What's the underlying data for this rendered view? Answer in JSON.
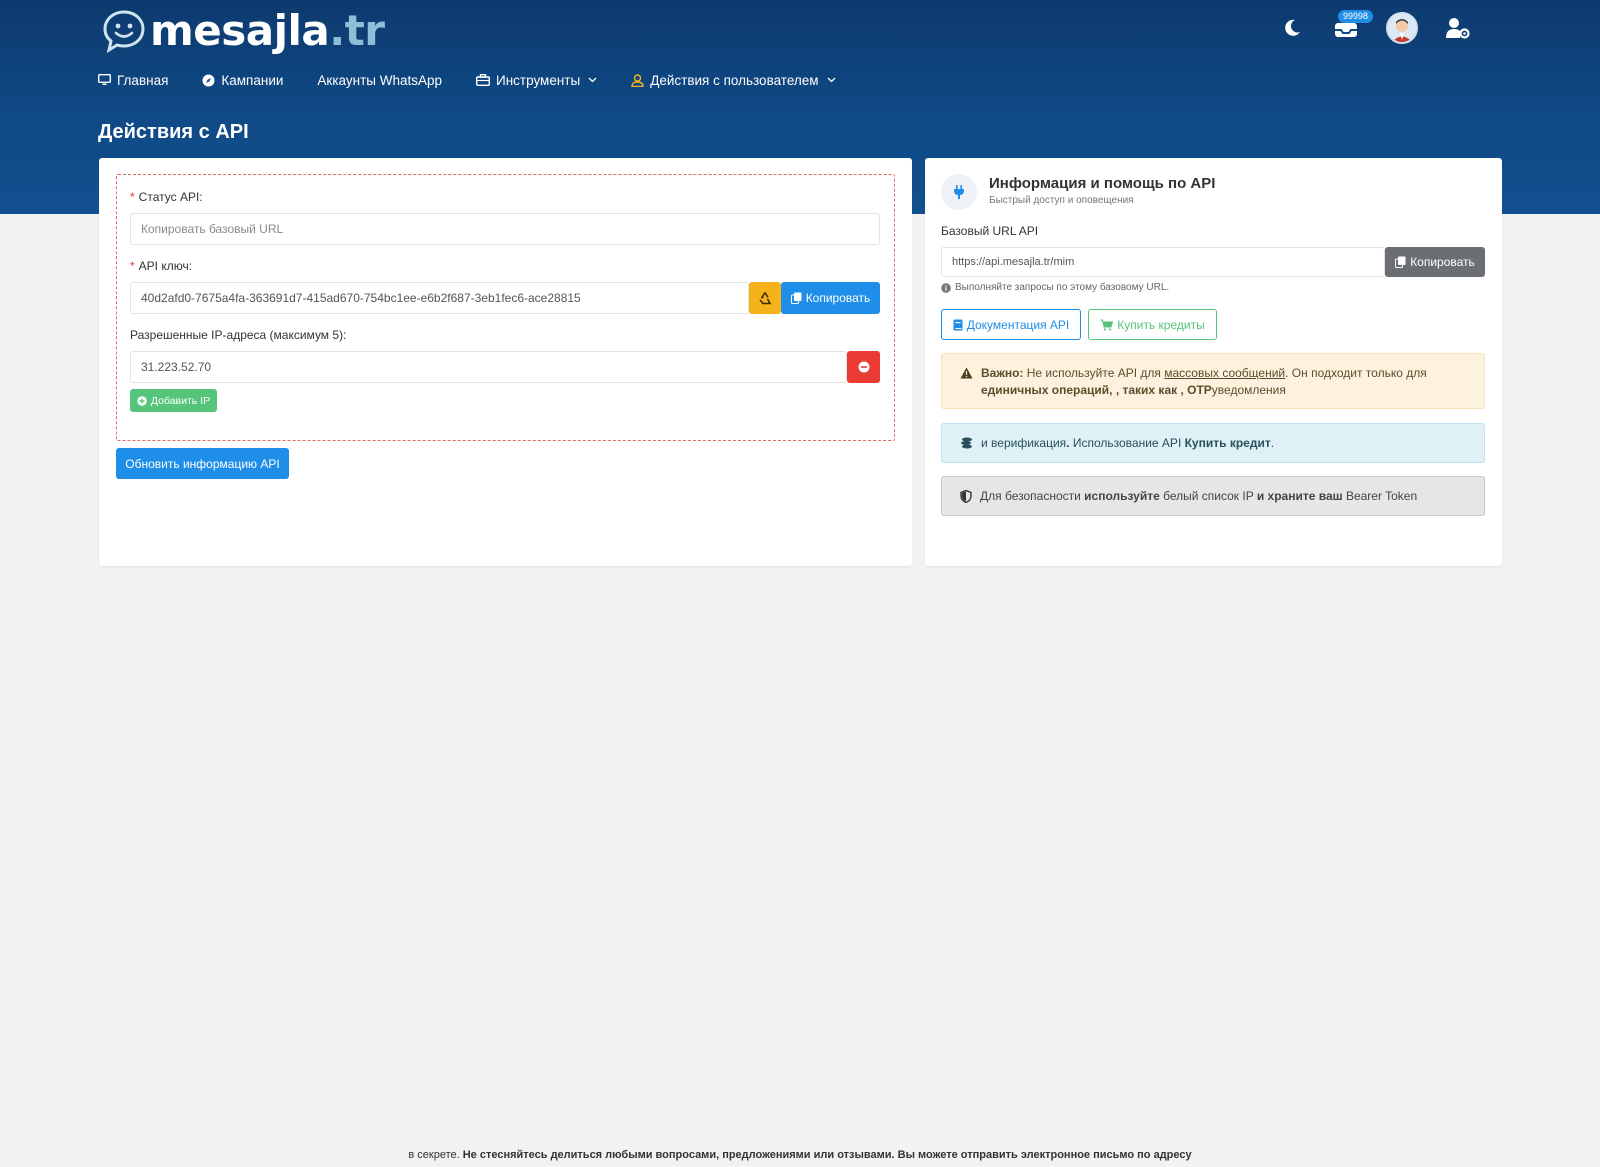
{
  "header": {
    "logo_text": "mesajla",
    "logo_tld": ".tr",
    "badge_count": "99998"
  },
  "nav": {
    "home": "Главная",
    "campaigns": "Кампании",
    "whatsapp_accounts": "Аккаунты WhatsApp",
    "tools": "Инструменты",
    "user_actions": "Действия с пользователем"
  },
  "page": {
    "title": "Действия с API"
  },
  "api_form": {
    "status_label": "Статус API:",
    "status_placeholder": "Копировать базовый URL",
    "key_label": "API ключ:",
    "key_value": "40d2afd0-7675a4fa-363691d7-415ad670-754bc1ee-e6b2f687-3eb1fec6-ace28815",
    "copy_label": "Копировать",
    "ip_label": "Разрешенные IP-адреса (максимум 5):",
    "ip_value": "31.223.52.70",
    "add_ip_label": "Добавить IP",
    "update_label": "Обновить информацию API"
  },
  "api_info": {
    "title": "Информация и помощь по API",
    "subtitle": "Быстрый доступ и оповещения",
    "base_url_label": "Базовый URL API",
    "base_url_value": "https://api.mesajla.tr/mim",
    "copy_label": "Копировать",
    "hint": "Выполняйте запросы по этому базовому URL.",
    "docs_label": "Документация API",
    "buy_credits_label": "Купить кредиты",
    "warning": {
      "strong": "Важно:",
      "text1": " Не используйте API для ",
      "link": "массовых сообщений",
      "text2": ". Он подходит только для",
      "bold2": "единичных операций",
      "bold3": ", , таких как , ",
      "bold4": "OTP",
      "text3": "уведомления"
    },
    "info": {
      "text1": "и верификация",
      "bold1": ".",
      "text2": " Использование API ",
      "bold2": "Купить кредит",
      "text3": "."
    },
    "security": {
      "text1": "Для безопасности ",
      "bold1": "используйте",
      "text2": " белый список IP ",
      "bold2": "и храните ваш",
      "text3": " Bearer Token"
    }
  },
  "footer": {
    "text1": "в секрете. ",
    "bold": "Не стесняйтесь делиться любыми вопросами, предложениями или отзывами. Вы можете отправить электронное письмо по адресу"
  },
  "colors": {
    "header_bg": "#0f4a86",
    "primary": "#1f8ee8",
    "danger": "#ea3b35",
    "warning": "#f5b21b",
    "success": "#56c47a"
  }
}
